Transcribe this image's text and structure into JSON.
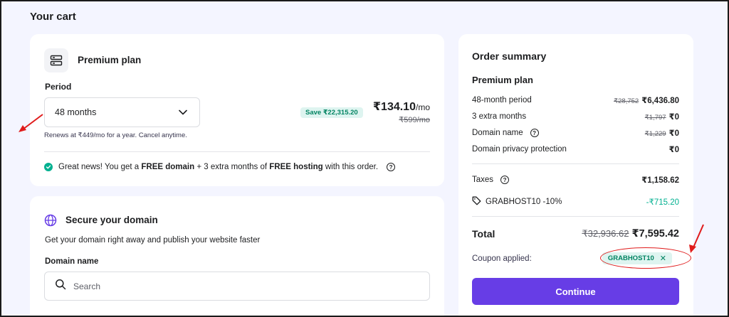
{
  "page_title": "Your cart",
  "plan_card": {
    "icon": "server-icon",
    "plan_name": "Premium plan",
    "period_label": "Period",
    "period_value": "48 months",
    "renews_note": "Renews at ₹449/mo for a year. Cancel anytime.",
    "save_badge": "Save ₹22,315.20",
    "price": "₹134.10",
    "price_unit": "/mo",
    "old_price": "₹599/mo",
    "great_news": {
      "prefix": "Great news! You get a ",
      "bold1": "FREE domain",
      "middle": " + 3 extra months of ",
      "bold2": "FREE hosting",
      "suffix": " with this order."
    }
  },
  "domain_card": {
    "title": "Secure your domain",
    "subtitle": "Get your domain right away and publish your website faster",
    "field_label": "Domain name",
    "search_placeholder": "Search"
  },
  "summary": {
    "title": "Order summary",
    "plan_name": "Premium plan",
    "rows": [
      {
        "label": "48-month period",
        "old": "₹28,752",
        "value": "₹6,436.80"
      },
      {
        "label": "3 extra months",
        "old": "₹1,797",
        "value": "₹0"
      },
      {
        "label": "Domain name",
        "old": "₹1,229",
        "value": "₹0"
      },
      {
        "label": "Domain privacy protection",
        "old": "",
        "value": "₹0"
      }
    ],
    "taxes_label": "Taxes",
    "taxes_value": "₹1,158.62",
    "discount_label": "GRABHOST10 -10%",
    "discount_value": "-₹715.20",
    "total_label": "Total",
    "total_old": "₹32,936.62",
    "total_value": "₹7,595.42",
    "coupon_label": "Coupon applied:",
    "coupon_code": "GRABHOST10",
    "coupon_remove": "✕",
    "continue_label": "Continue"
  },
  "colors": {
    "accent": "#673de6",
    "success": "#00b090",
    "annotation": "#e01b1b"
  }
}
